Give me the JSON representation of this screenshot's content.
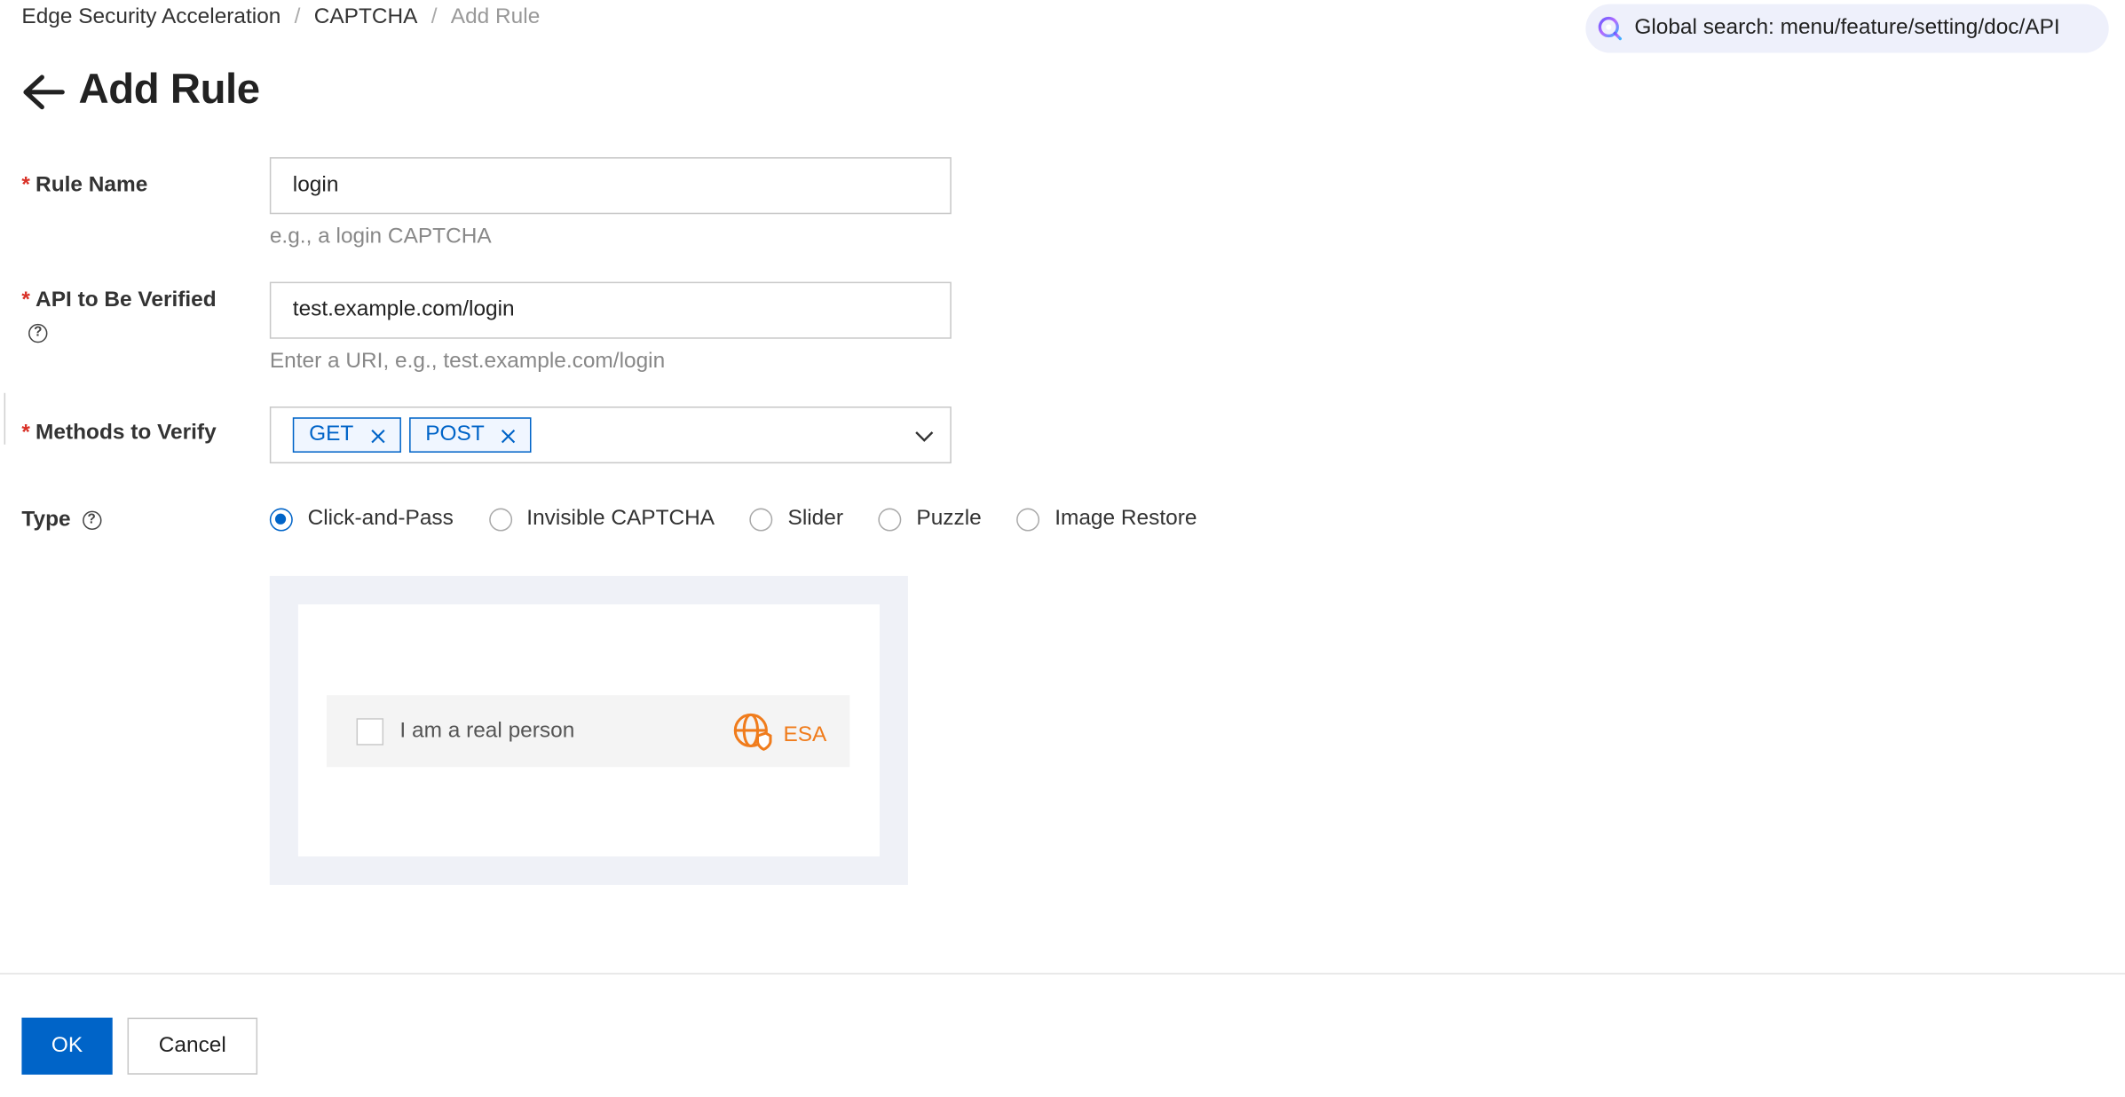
{
  "breadcrumb": {
    "items": [
      "Edge Security Acceleration",
      "CAPTCHA",
      "Add Rule"
    ],
    "separator": "/"
  },
  "global_search": {
    "label": "Global search: menu/feature/setting/doc/API",
    "icon": "ai-search-icon"
  },
  "header": {
    "title": "Add Rule",
    "back_icon": "arrow-left-icon"
  },
  "form": {
    "required_mark": "*",
    "rule_name": {
      "label": "Rule Name",
      "value": "login",
      "hint": "e.g., a login CAPTCHA"
    },
    "api": {
      "label": "API to Be Verified",
      "value": "test.example.com/login",
      "hint": "Enter a URI, e.g., test.example.com/login",
      "help": "?"
    },
    "methods": {
      "label": "Methods to Verify",
      "tags": [
        "GET",
        "POST"
      ]
    },
    "type": {
      "label": "Type",
      "help": "?",
      "options": [
        "Click-and-Pass",
        "Invisible CAPTCHA",
        "Slider",
        "Puzzle",
        "Image Restore"
      ],
      "selected": "Click-and-Pass"
    }
  },
  "preview": {
    "checkbox_label": "I am a real person",
    "brand": "ESA",
    "brand_color": "#f07c1c"
  },
  "footer": {
    "ok": "OK",
    "cancel": "Cancel"
  },
  "colors": {
    "primary": "#0064c8",
    "required": "#d93026",
    "search_bg": "#eef0fb",
    "preview_bg": "#eff1f7"
  }
}
